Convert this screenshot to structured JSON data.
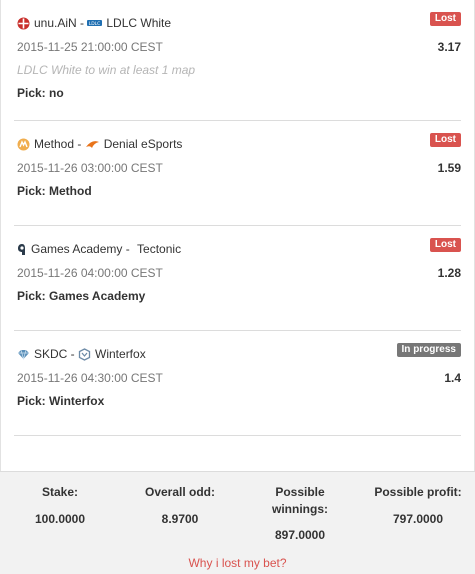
{
  "bets": [
    {
      "team1": "unu.AiN",
      "team2": "LDLC White",
      "separator": " - ",
      "date": "2015-11-25 21:00:00 CEST",
      "odd": "3.17",
      "status": "Lost",
      "note": "LDLC White to win at least 1 map",
      "pick": "Pick: no",
      "team1_icon": "unuain-logo-icon",
      "team2_icon": "ldlc-logo-icon"
    },
    {
      "team1": "Method",
      "team2": "Denial eSports",
      "separator": " - ",
      "date": "2015-11-26 03:00:00 CEST",
      "odd": "1.59",
      "status": "Lost",
      "pick": "Pick: Method",
      "team1_icon": "method-logo-icon",
      "team2_icon": "denial-logo-icon"
    },
    {
      "team1": "Games Academy",
      "team2": "Tectonic",
      "separator": " - ",
      "date": "2015-11-26 04:00:00 CEST",
      "odd": "1.28",
      "status": "Lost",
      "pick": "Pick: Games Academy",
      "team1_icon": "games-academy-logo-icon"
    },
    {
      "team1": "SKDC",
      "team2": "Winterfox",
      "separator": " - ",
      "date": "2015-11-26 04:30:00 CEST",
      "odd": "1.4",
      "status": "In progress",
      "pick": "Pick: Winterfox",
      "team1_icon": "skdc-logo-icon",
      "team2_icon": "winterfox-logo-icon"
    }
  ],
  "summary": {
    "stake_label": "Stake:",
    "stake_value": "100.0000",
    "odd_label": "Overall odd:",
    "odd_value": "8.9700",
    "winnings_label": "Possible winnings:",
    "winnings_value": "897.0000",
    "profit_label": "Possible profit:",
    "profit_value": "797.0000"
  },
  "why_link": "Why i lost my bet?",
  "colors": {
    "lost_badge": "#d9534f",
    "progress_badge": "#777777",
    "link": "#d9534f",
    "summary_bg": "#f2f2f2"
  }
}
